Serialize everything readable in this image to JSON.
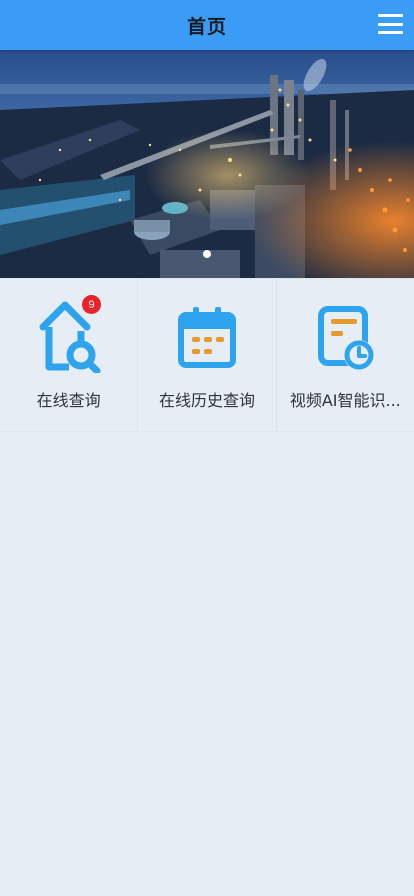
{
  "header": {
    "title": "首页",
    "menu_icon": "hamburger-menu-icon",
    "background": "#3a9cf5"
  },
  "banner": {
    "subject": "industrial-plant-night-photo",
    "slide_count_visible": 1
  },
  "grid": {
    "items": [
      {
        "label": "在线查询",
        "icon": "house-search-icon",
        "badge": "9"
      },
      {
        "label": "在线历史查询",
        "icon": "calendar-icon"
      },
      {
        "label": "视频AI智能识...",
        "icon": "document-clock-icon"
      }
    ]
  },
  "colors": {
    "icon_blue": "#2fa4ee",
    "icon_orange": "#e69a2b",
    "badge_red": "#e8232a",
    "page_background": "#e6edf4"
  }
}
